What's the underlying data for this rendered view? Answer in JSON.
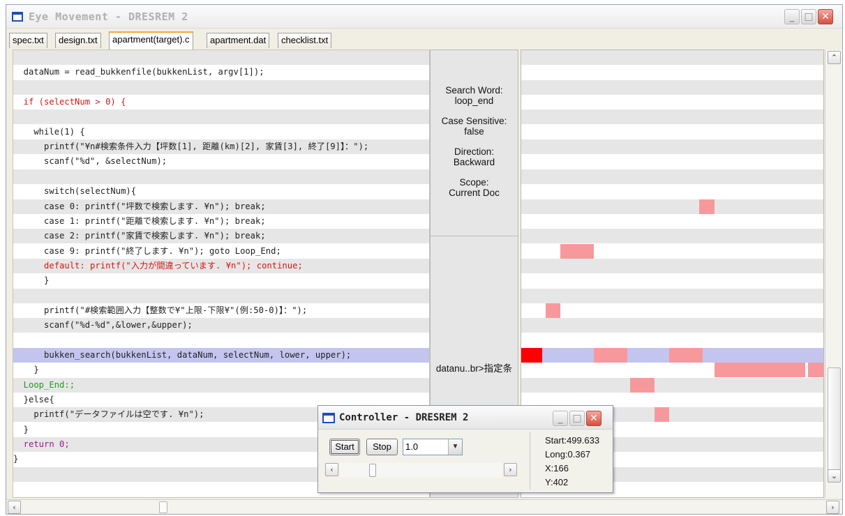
{
  "window": {
    "title": "Eye Movement - DRESREM 2"
  },
  "tabs": [
    {
      "label": "spec.txt"
    },
    {
      "label": "design.txt"
    },
    {
      "label": "apartment(target).c"
    },
    {
      "label": "apartment.dat"
    },
    {
      "label": "checklist.txt"
    }
  ],
  "active_tab": "apartment(target).c",
  "code_lines": [
    {
      "text": "",
      "color": "default"
    },
    {
      "text": "  dataNum = read_bukkenfile(bukkenList, argv[1]);",
      "color": "default"
    },
    {
      "text": "",
      "color": "default"
    },
    {
      "text": "  if (selectNum > 0) {",
      "color": "red"
    },
    {
      "text": "",
      "color": "default"
    },
    {
      "text": "    while(1) {",
      "color": "default"
    },
    {
      "text": "      printf(\"¥n#検索条件入力【坪数[1], 距離(km)[2], 家賃[3], 終了[9]】：\");",
      "color": "default"
    },
    {
      "text": "      scanf(\"%d\", &selectNum);",
      "color": "default"
    },
    {
      "text": "",
      "color": "default"
    },
    {
      "text": "      switch(selectNum){",
      "color": "default"
    },
    {
      "text": "      case 0: printf(\"坪数で検索します. ¥n\"); break;",
      "color": "default"
    },
    {
      "text": "      case 1: printf(\"距離で検索します. ¥n\"); break;",
      "color": "default"
    },
    {
      "text": "      case 2: printf(\"家賃で検索します. ¥n\"); break;",
      "color": "default"
    },
    {
      "text": "      case 9: printf(\"終了します. ¥n\"); goto Loop_End;",
      "color": "default"
    },
    {
      "text": "      default: printf(\"入力が間違っています. ¥n\"); continue;",
      "color": "red"
    },
    {
      "text": "      }",
      "color": "default"
    },
    {
      "text": "",
      "color": "default"
    },
    {
      "text": "      printf(\"#検索範囲入力【整数で¥\"上限-下限¥\"(例:50-0)】：\");",
      "color": "default"
    },
    {
      "text": "      scanf(\"%d-%d\",&lower,&upper);",
      "color": "default"
    },
    {
      "text": "",
      "color": "default"
    },
    {
      "text": "      bukken_search(bukkenList, dataNum, selectNum, lower, upper);",
      "color": "default"
    },
    {
      "text": "    }",
      "color": "default"
    },
    {
      "text": "  Loop_End:;",
      "color": "green"
    },
    {
      "text": "  }else{",
      "color": "default"
    },
    {
      "text": "    printf(\"データファイルは空です. ¥n\");",
      "color": "default"
    },
    {
      "text": "  }",
      "color": "default"
    },
    {
      "text": "  return 0;",
      "color": "purple"
    },
    {
      "text": "}",
      "color": "default"
    }
  ],
  "highlighted_line": 20,
  "search_panel": {
    "search_word_label": "Search Word:",
    "search_word_value": "loop_end",
    "case_sensitive_label": "Case Sensitive:",
    "case_sensitive_value": "false",
    "direction_label": "Direction:",
    "direction_value": "Backward",
    "scope_label": "Scope:",
    "scope_value": "Current Doc",
    "trace_text": "datanu..br>指定条"
  },
  "gaze_marks": [
    {
      "line": 10,
      "start": 0.59,
      "end": 0.64,
      "color": "#f7999c"
    },
    {
      "line": 13,
      "start": 0.13,
      "end": 0.24,
      "color": "#f7999c"
    },
    {
      "line": 17,
      "start": 0.08,
      "end": 0.13,
      "color": "#f7999c"
    },
    {
      "line": 20,
      "start": 0.0,
      "end": 0.07,
      "color": "#ff0000"
    },
    {
      "line": 20,
      "start": 0.24,
      "end": 0.35,
      "color": "#f7999c"
    },
    {
      "line": 20,
      "start": 0.49,
      "end": 0.6,
      "color": "#f7999c"
    },
    {
      "line": 21,
      "start": 0.64,
      "end": 0.94,
      "color": "#f7999c"
    },
    {
      "line": 21,
      "start": 0.95,
      "end": 1.0,
      "color": "#f7999c"
    },
    {
      "line": 22,
      "start": 0.36,
      "end": 0.44,
      "color": "#f7999c"
    },
    {
      "line": 24,
      "start": 0.44,
      "end": 0.49,
      "color": "#f7999c"
    }
  ],
  "controller": {
    "title": "Controller - DRESREM 2",
    "start_label": "Start",
    "stop_label": "Stop",
    "speed_value": "1.0",
    "slider_position": 0.2,
    "stat_start": "Start:499.633",
    "stat_long": "Long:0.367",
    "stat_x": "X:166",
    "stat_y": "Y:402"
  },
  "colors": {
    "highlight_row": "#c3c5ef",
    "stripe": "#e6e6e6",
    "gaze_light": "#f7999c",
    "gaze_strong": "#ff0000"
  }
}
